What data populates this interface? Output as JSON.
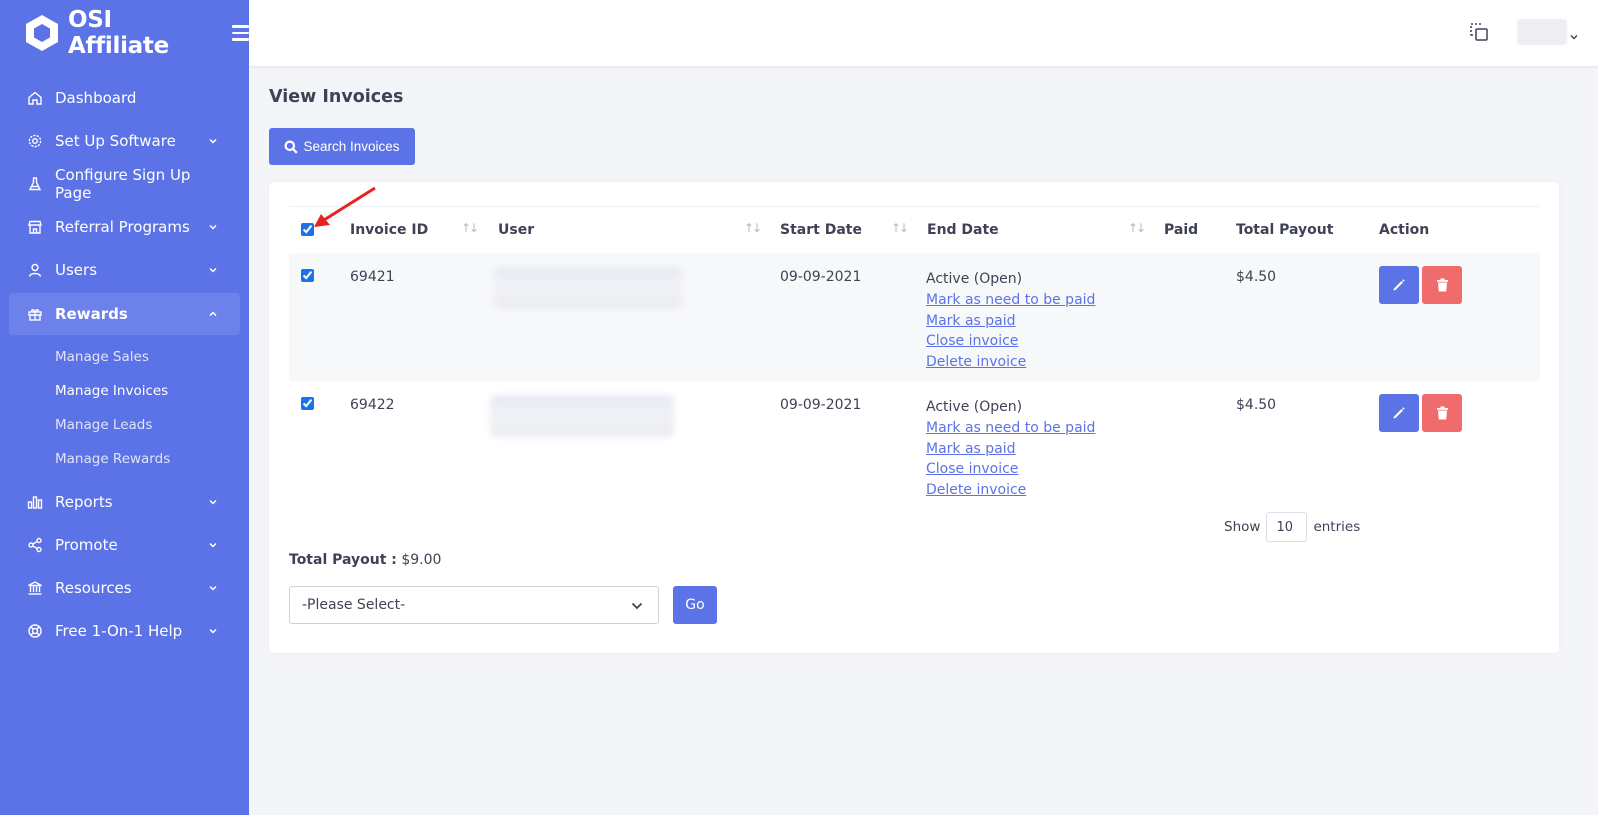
{
  "brand": {
    "name": "OSI Affiliate"
  },
  "sidebar": {
    "items": [
      {
        "label": "Dashboard",
        "icon": "home-icon",
        "has_chevron": false
      },
      {
        "label": "Set Up Software",
        "icon": "gear-icon",
        "has_chevron": true
      },
      {
        "label": "Configure Sign Up Page",
        "icon": "flask-icon",
        "has_chevron": false
      },
      {
        "label": "Referral Programs",
        "icon": "store-icon",
        "has_chevron": true
      },
      {
        "label": "Users",
        "icon": "user-icon",
        "has_chevron": true
      },
      {
        "label": "Rewards",
        "icon": "gift-icon",
        "has_chevron": true,
        "expanded": true
      },
      {
        "label": "Reports",
        "icon": "bar-chart-icon",
        "has_chevron": true
      },
      {
        "label": "Promote",
        "icon": "share-icon",
        "has_chevron": true
      },
      {
        "label": "Resources",
        "icon": "bank-icon",
        "has_chevron": true
      },
      {
        "label": "Free 1-On-1 Help",
        "icon": "lifebuoy-icon",
        "has_chevron": true
      }
    ],
    "rewards_sub": [
      {
        "label": "Manage Sales",
        "active": false
      },
      {
        "label": "Manage Invoices",
        "active": true
      },
      {
        "label": "Manage Leads",
        "active": false
      },
      {
        "label": "Manage Rewards",
        "active": false
      }
    ]
  },
  "page": {
    "title": "View Invoices",
    "search_button": "Search Invoices"
  },
  "table": {
    "columns": [
      "Invoice ID",
      "User",
      "Start Date",
      "End Date",
      "Paid",
      "Total Payout",
      "Action"
    ],
    "rows": [
      {
        "checked": true,
        "invoice_id": "69421",
        "start_date": "09-09-2021",
        "status": "Active (Open)",
        "links": [
          "Mark as need to be paid",
          "Mark as paid",
          "Close invoice",
          "Delete invoice"
        ],
        "paid": "",
        "total_payout": "$4.50"
      },
      {
        "checked": true,
        "invoice_id": "69422",
        "start_date": "09-09-2021",
        "status": "Active (Open)",
        "links": [
          "Mark as need to be paid",
          "Mark as paid",
          "Close invoice",
          "Delete invoice"
        ],
        "paid": "",
        "total_payout": "$4.50"
      }
    ]
  },
  "entries": {
    "show_label": "Show",
    "value": "10",
    "entries_label": "entries"
  },
  "summary": {
    "total_payout_label": "Total Payout :",
    "total_payout_value": "$9.00"
  },
  "bulk": {
    "select_value": "-Please Select-",
    "go_label": "Go"
  },
  "colors": {
    "primary": "#5c73e7",
    "danger": "#f06b6b",
    "annotation_arrow": "#e8231f"
  }
}
